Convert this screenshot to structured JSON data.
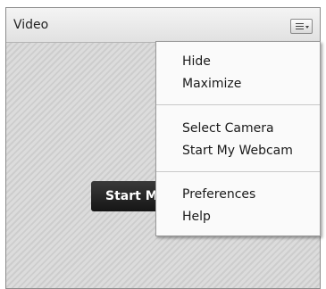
{
  "pod": {
    "title": "Video",
    "menu_icon": "menu-lines-icon",
    "start_button_label": "Start My Webcam"
  },
  "menu": {
    "items": [
      {
        "label": "Hide"
      },
      {
        "label": "Maximize"
      },
      {
        "label": "Select Camera"
      },
      {
        "label": "Start My Webcam"
      },
      {
        "label": "Preferences"
      },
      {
        "label": "Help"
      }
    ]
  },
  "colors": {
    "menu_background": "#fafafa",
    "start_button": "#1f1f1f",
    "body_stripes": "#d6d6d6"
  }
}
